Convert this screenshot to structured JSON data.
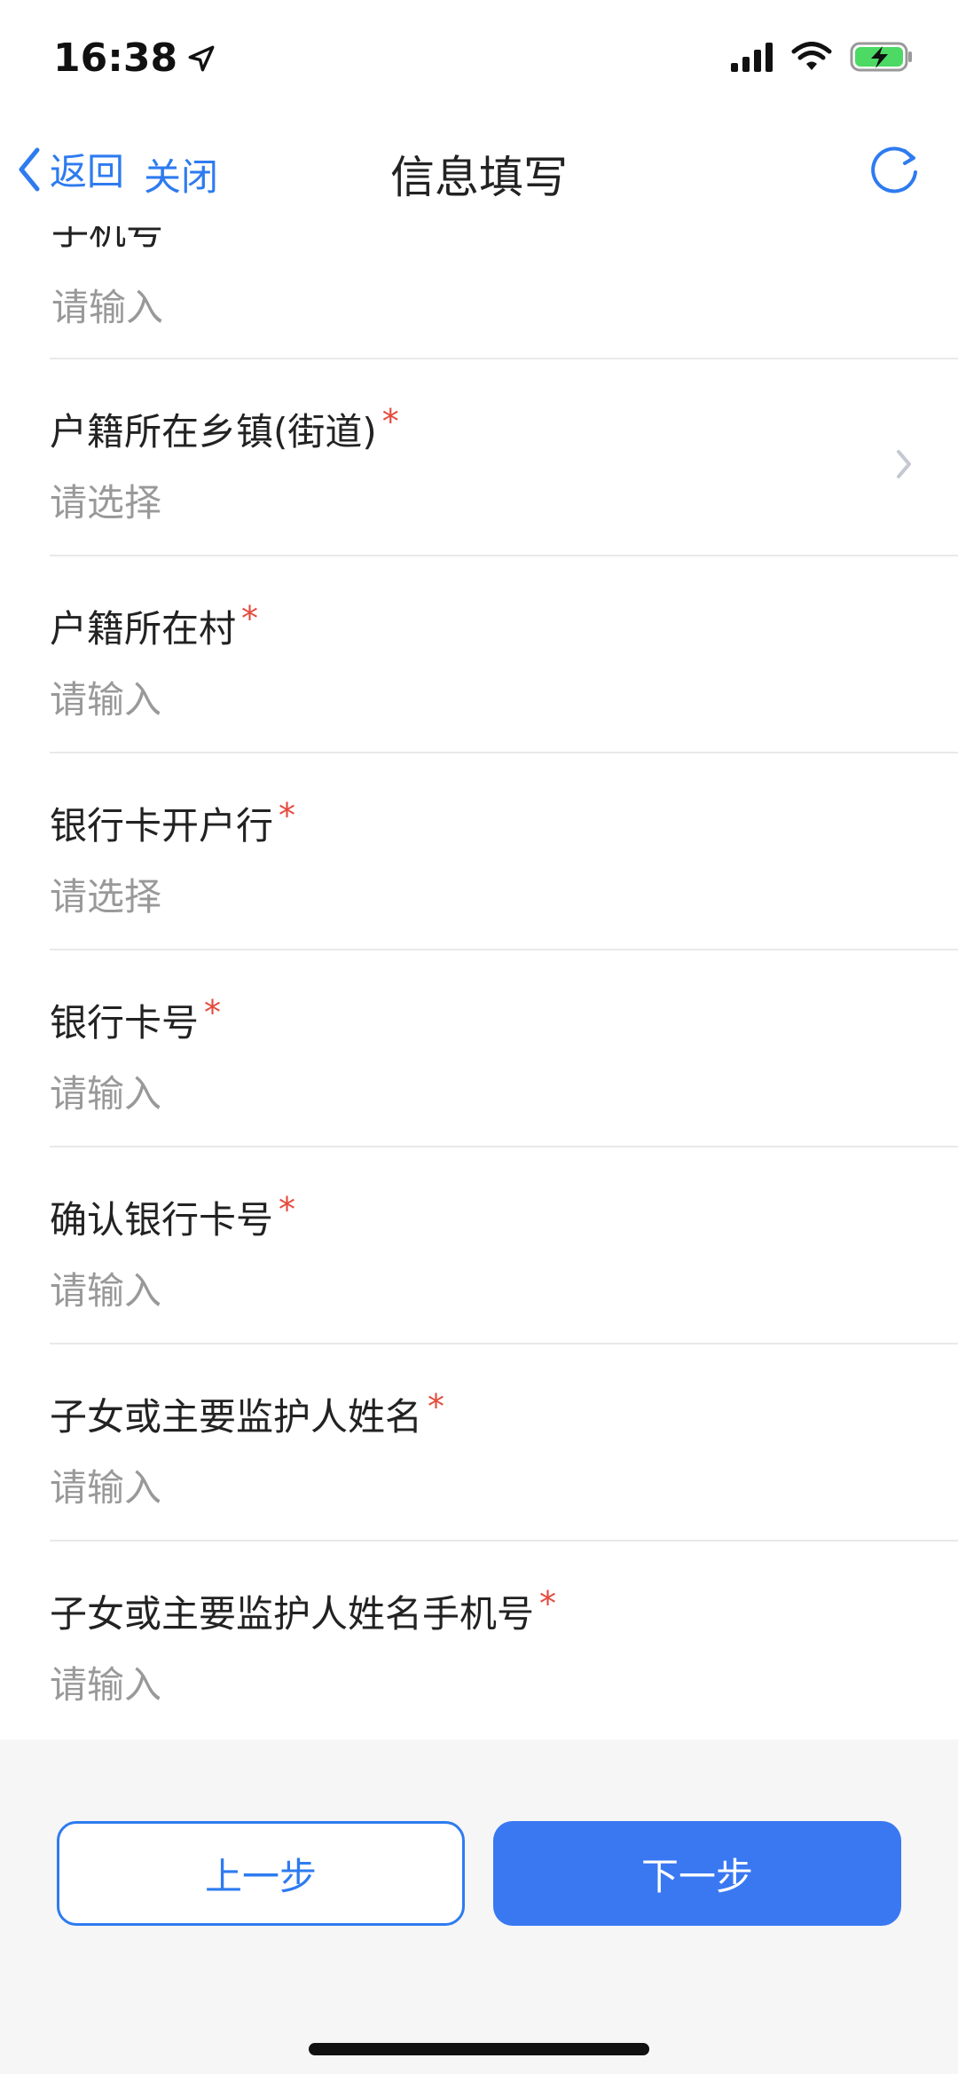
{
  "status_bar": {
    "time": "16:38",
    "icons": [
      "location-arrow-icon",
      "signal-icon",
      "wifi-icon",
      "battery-charging-icon"
    ],
    "battery_color": "#4cd964"
  },
  "nav": {
    "back_label": "返回",
    "close_label": "关闭",
    "title": "信息填写",
    "refresh_icon": "refresh-icon",
    "accent_color": "#2e7bf0"
  },
  "form": {
    "partial_label": "手机号",
    "partial_value": "请输入",
    "rows": [
      {
        "label": "户籍所在乡镇(街道)",
        "required": "*",
        "value": "请选择",
        "has_chevron": true
      },
      {
        "label": "户籍所在村",
        "required": "*",
        "value": "请输入",
        "has_chevron": false
      },
      {
        "label": "银行卡开户行",
        "required": "*",
        "value": "请选择",
        "has_chevron": false
      },
      {
        "label": "银行卡号",
        "required": "*",
        "value": "请输入",
        "has_chevron": false
      },
      {
        "label": "确认银行卡号",
        "required": "*",
        "value": "请输入",
        "has_chevron": false
      },
      {
        "label": "子女或主要监护人姓名",
        "required": "*",
        "value": "请输入",
        "has_chevron": false
      },
      {
        "label": "子女或主要监护人姓名手机号",
        "required": "*",
        "value": "请输入",
        "has_chevron": false
      }
    ]
  },
  "footer": {
    "prev_label": "上一步",
    "next_label": "下一步",
    "primary_color": "#3a78f2"
  }
}
